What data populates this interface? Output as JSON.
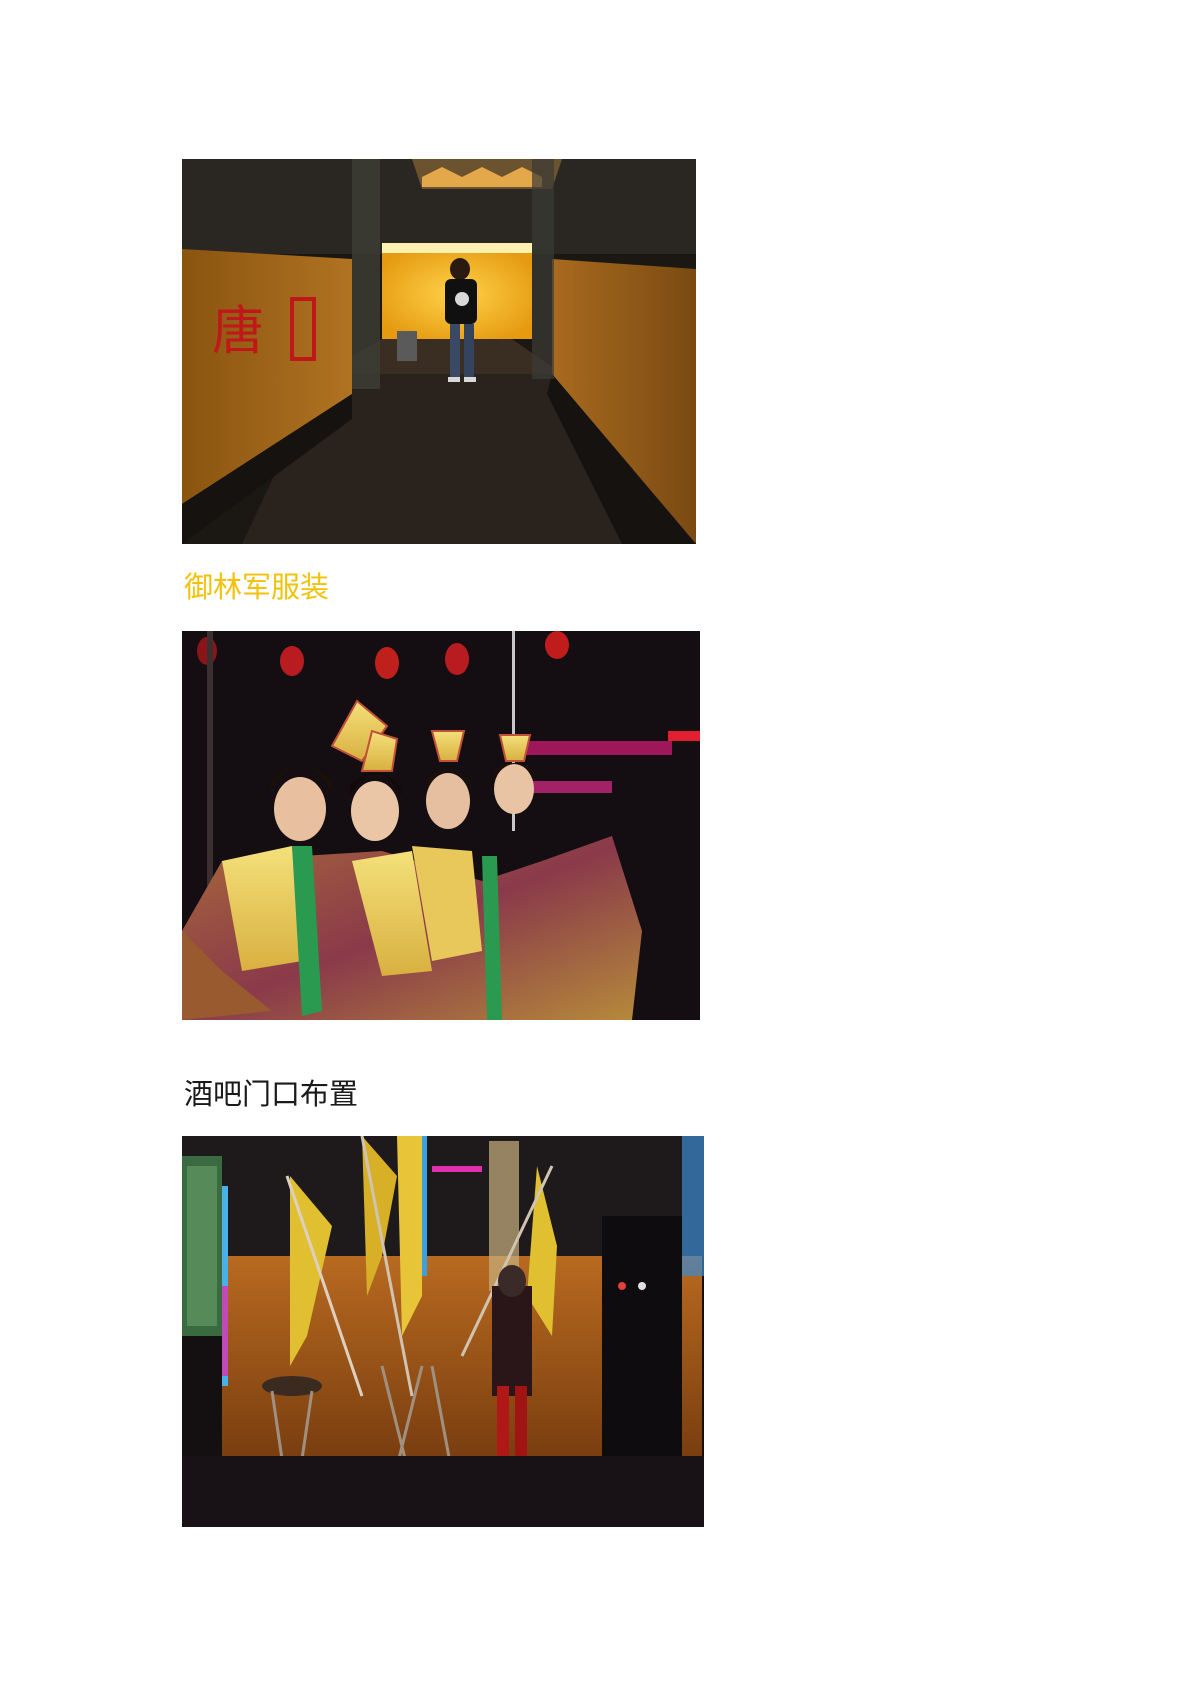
{
  "page": {
    "background": "#ffffff"
  },
  "captions": [
    {
      "text": "御林军服装",
      "color": "#f2c20a"
    },
    {
      "text": "酒吧门口布置",
      "color": "#1a1a1a"
    }
  ],
  "photos": [
    {
      "subject": "bar-corridor-photo",
      "sign_text": "唐"
    },
    {
      "subject": "costumed-performers-photo"
    },
    {
      "subject": "bar-entrance-flags-photo"
    }
  ]
}
